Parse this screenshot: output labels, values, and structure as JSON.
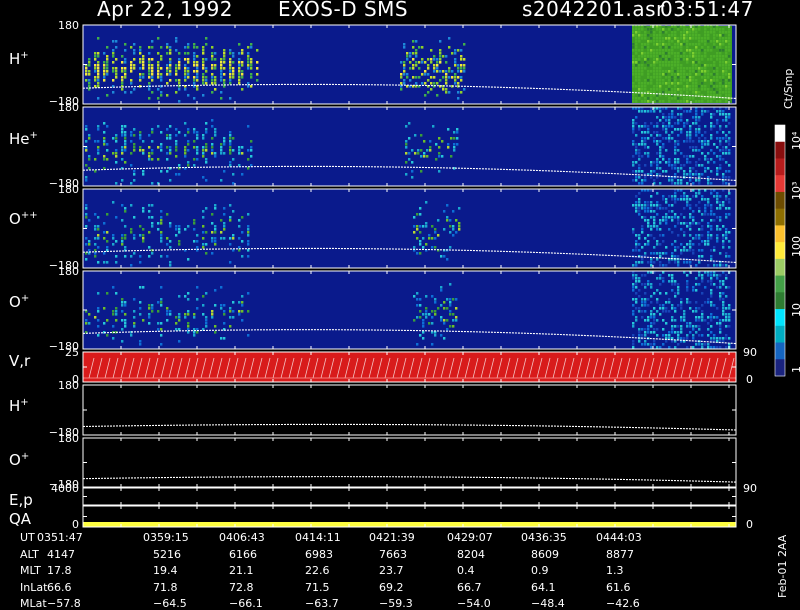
{
  "header": {
    "date": "Apr 22, 1992",
    "instrument": "EXOS-D SMS",
    "file_id": "s2042201.asr",
    "time": "03:51:47"
  },
  "colors": {
    "background": "#000000",
    "frame": "#ffffff",
    "spectro_background": "#0a1a8c",
    "velocity_panel": "#d81b1b",
    "qa_bar": "#ffff40",
    "trace": "#ffffff"
  },
  "panels": [
    {
      "label": "H",
      "charge": "+",
      "ymax": "180",
      "ymin": "−180"
    },
    {
      "label": "He",
      "charge": "+",
      "ymax": "180",
      "ymin": "−180"
    },
    {
      "label": "O",
      "charge": "++",
      "ymax": "180",
      "ymin": "−180"
    },
    {
      "label": "O",
      "charge": "+",
      "ymax": "180",
      "ymin": "−180"
    },
    {
      "label": "V,r",
      "charge": "",
      "ymax": "25",
      "ymin": "0",
      "right_max": "90",
      "right_min": "0"
    },
    {
      "label": "H",
      "charge": "+",
      "ymax": "180",
      "ymin": "−180"
    },
    {
      "label": "O",
      "charge": "+",
      "ymax": "180",
      "ymin": "−180"
    },
    {
      "label": "E,p",
      "charge": "",
      "ymax": "4000",
      "right_max": "90"
    },
    {
      "label": "QA",
      "charge": "",
      "ymin": "0",
      "right_min": "0"
    }
  ],
  "colorbar": {
    "title": "Ct/Smp",
    "tick_labels": [
      "1",
      "10",
      "100",
      "10³",
      "10⁴"
    ],
    "colors": [
      "#1a237e",
      "#1565c0",
      "#00acc1",
      "#00e5ff",
      "#2e7d32",
      "#43a047",
      "#9ccc65",
      "#ffeb3b",
      "#fbc02d",
      "#8d6e00",
      "#6d4c00",
      "#e53935",
      "#b71c1c",
      "#880e0e",
      "#ffffff"
    ]
  },
  "table": {
    "rows": [
      {
        "label": "UT",
        "values": [
          "0351:47",
          "0359:15",
          "0406:43",
          "0414:11",
          "0421:39",
          "0429:07",
          "0436:35",
          "0444:03"
        ]
      },
      {
        "label": "ALT",
        "values": [
          "4147",
          "5216",
          "6166",
          "6983",
          "7663",
          "8204",
          "8609",
          "8877"
        ]
      },
      {
        "label": "MLT",
        "values": [
          "17.8",
          "19.4",
          "21.1",
          "22.6",
          "23.7",
          "0.4",
          "0.9",
          "1.3"
        ]
      },
      {
        "label": "InLat",
        "values": [
          "66.6",
          "71.8",
          "72.8",
          "71.5",
          "69.2",
          "66.7",
          "64.1",
          "61.6"
        ]
      },
      {
        "label": "MLat",
        "values": [
          "−57.8",
          "−64.5",
          "−66.1",
          "−63.7",
          "−59.3",
          "−54.0",
          "−48.4",
          "−42.6"
        ]
      }
    ]
  },
  "footer_note": "Feb-01 2AA"
}
